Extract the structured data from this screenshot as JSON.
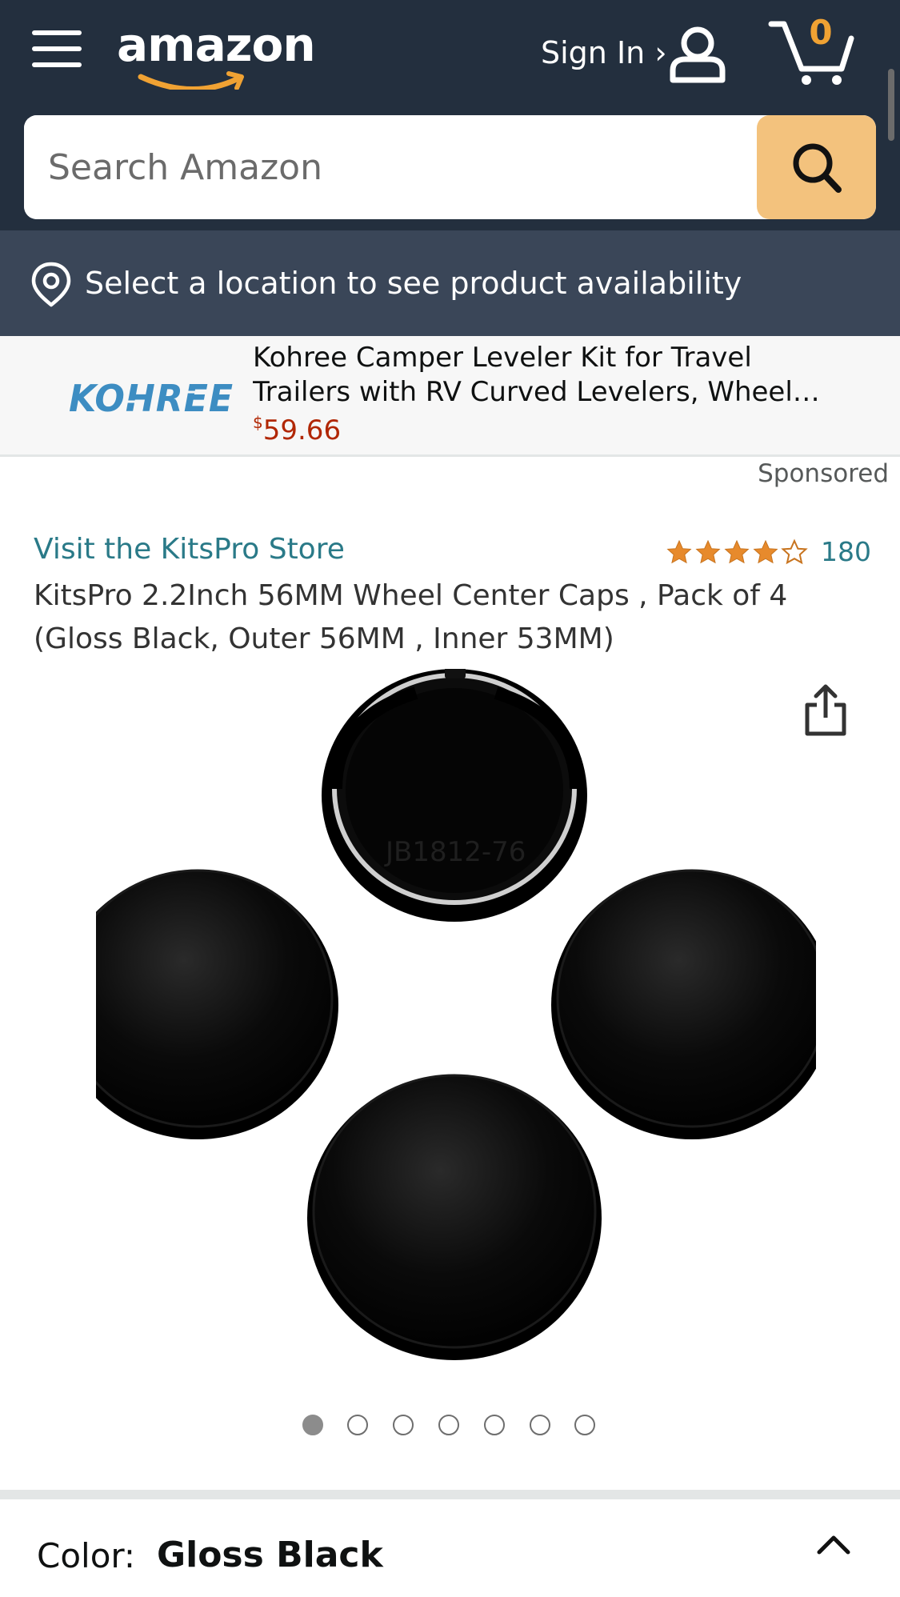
{
  "header": {
    "logo_text": "amazon",
    "sign_in_label": "Sign In ›",
    "cart_count": "0"
  },
  "search": {
    "placeholder": "Search Amazon"
  },
  "location": {
    "text": "Select a location to see product availability"
  },
  "sponsored_banner": {
    "brand_logo_text": "KOHREE",
    "title_line1": "Kohree Camper Leveler Kit for Travel",
    "title_line2": "Trailers with RV Curved Levelers, Wheel…",
    "price_currency": "$",
    "price_value": "59.66"
  },
  "sponsored_label": "Sponsored",
  "product": {
    "store_link": "Visit the KitsPro Store",
    "rating_stars": 4.5,
    "rating_count": "180",
    "title": "KitsPro 2.2Inch 56MM Wheel Center Caps , Pack of 4 (Gloss Black, Outer 56MM , Inner 53MM)",
    "image_count": 7,
    "active_image_index": 0,
    "color_label": "Color:",
    "color_value": "Gloss Black"
  },
  "colors": {
    "header_bg": "#232f3e",
    "location_bg": "#3a4658",
    "search_button": "#f3c27d",
    "cart_count": "#f0a233",
    "link": "#2a7a88",
    "price": "#b12704",
    "star": "#e78a2c",
    "kohree_blue": "#3d8dc2"
  },
  "icons": {
    "menu": "hamburger-menu-icon",
    "user": "user-icon",
    "cart": "cart-icon",
    "search": "search-icon",
    "pin": "location-pin-icon",
    "share": "share-icon",
    "chevron": "chevron-up-icon"
  }
}
